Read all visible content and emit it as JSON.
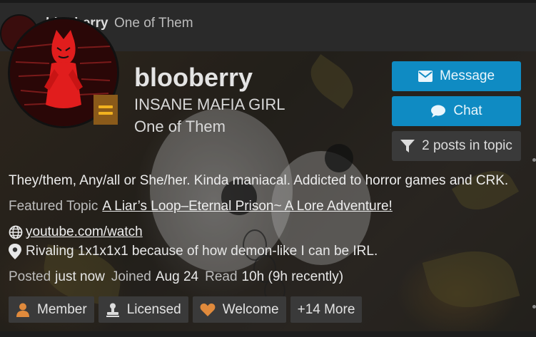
{
  "previous_post": {
    "username": "blooberry",
    "user_title": "One of Them"
  },
  "profile": {
    "username": "blooberry",
    "subtitle": "INSANE MAFIA GIRL",
    "user_title": "One of Them",
    "avatar_icon": "avatar-image",
    "rank_badge_icon": "rank-badge-icon",
    "bio": "They/them, Any/all or She/her. Kinda maniacal. Addicted to horror games and CRK.",
    "featured_topic_label": "Featured Topic",
    "featured_topic": "A Liar’s Loop–Eternal Prison~ A Lore Adventure!",
    "website": "youtube.com/watch",
    "location": "Rivaling 1x1x1x1 because of how demon-like I can be IRL.",
    "stats": {
      "posted_label": "Posted",
      "posted_value": "just now",
      "joined_label": "Joined",
      "joined_value": "Aug 24",
      "read_label": "Read",
      "read_value": "10h (9h recently)"
    }
  },
  "actions": {
    "message_label": "Message",
    "chat_label": "Chat",
    "filter_label": "2 posts in topic"
  },
  "badges": [
    {
      "label": "Member",
      "icon": "user-icon"
    },
    {
      "label": "Licensed",
      "icon": "stamp-icon"
    },
    {
      "label": "Welcome",
      "icon": "heart-icon"
    },
    {
      "label": "+14 More"
    }
  ],
  "colors": {
    "accent": "#0f8bc3",
    "badge_member": "#e08a3c",
    "badge_welcome": "#e08a3c",
    "rank_badge": "#f1b21f"
  }
}
